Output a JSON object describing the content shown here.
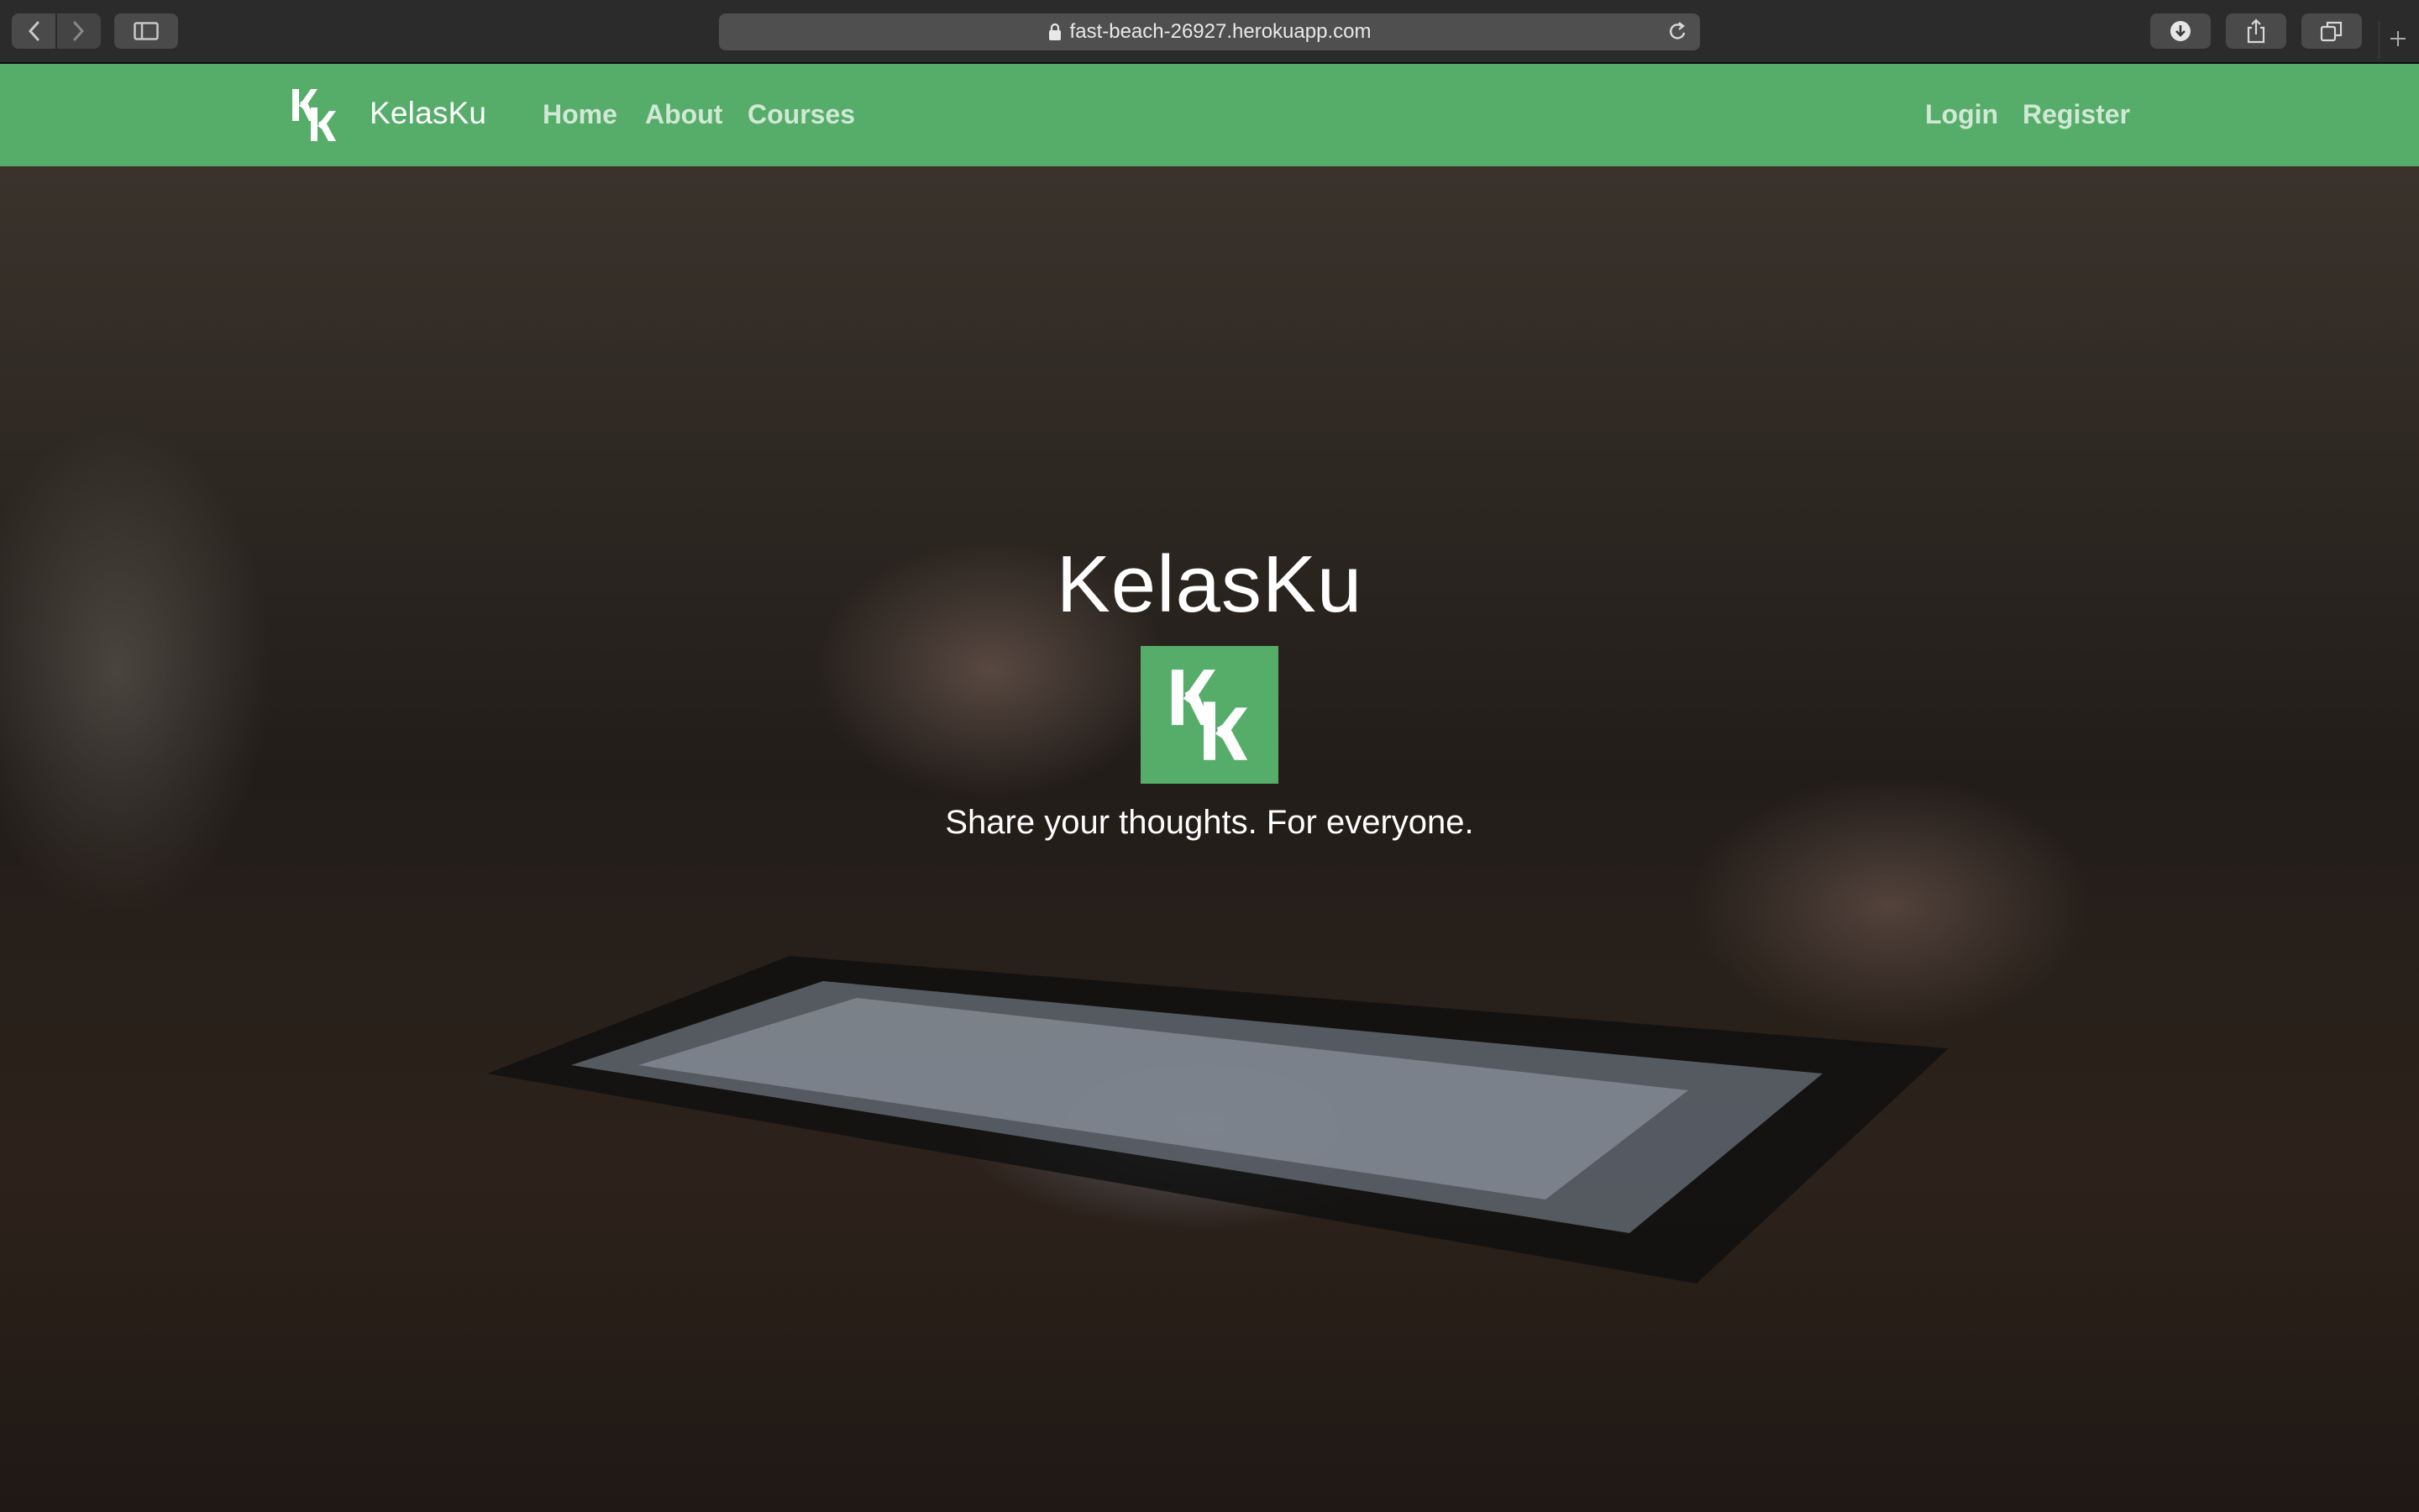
{
  "browser": {
    "url": "fast-beach-26927.herokuapp.com",
    "icons": {
      "back": "chevron-left-icon",
      "forward": "chevron-right-icon",
      "sidebar": "sidebar-icon",
      "lock": "lock-icon",
      "reload": "reload-icon",
      "download": "download-icon",
      "share": "share-icon",
      "tabs": "tabs-icon",
      "new_tab": "plus-icon"
    }
  },
  "navbar": {
    "brand_logo_text": "Kk",
    "brand_name": "KelasKu",
    "links_left": [
      "Home",
      "About",
      "Courses"
    ],
    "links_right": [
      "Login",
      "Register"
    ],
    "color": "#56ad6a"
  },
  "hero": {
    "title": "KelasKu",
    "logo_text": "Kk",
    "tagline": "Share your thoughts. For everyone."
  }
}
